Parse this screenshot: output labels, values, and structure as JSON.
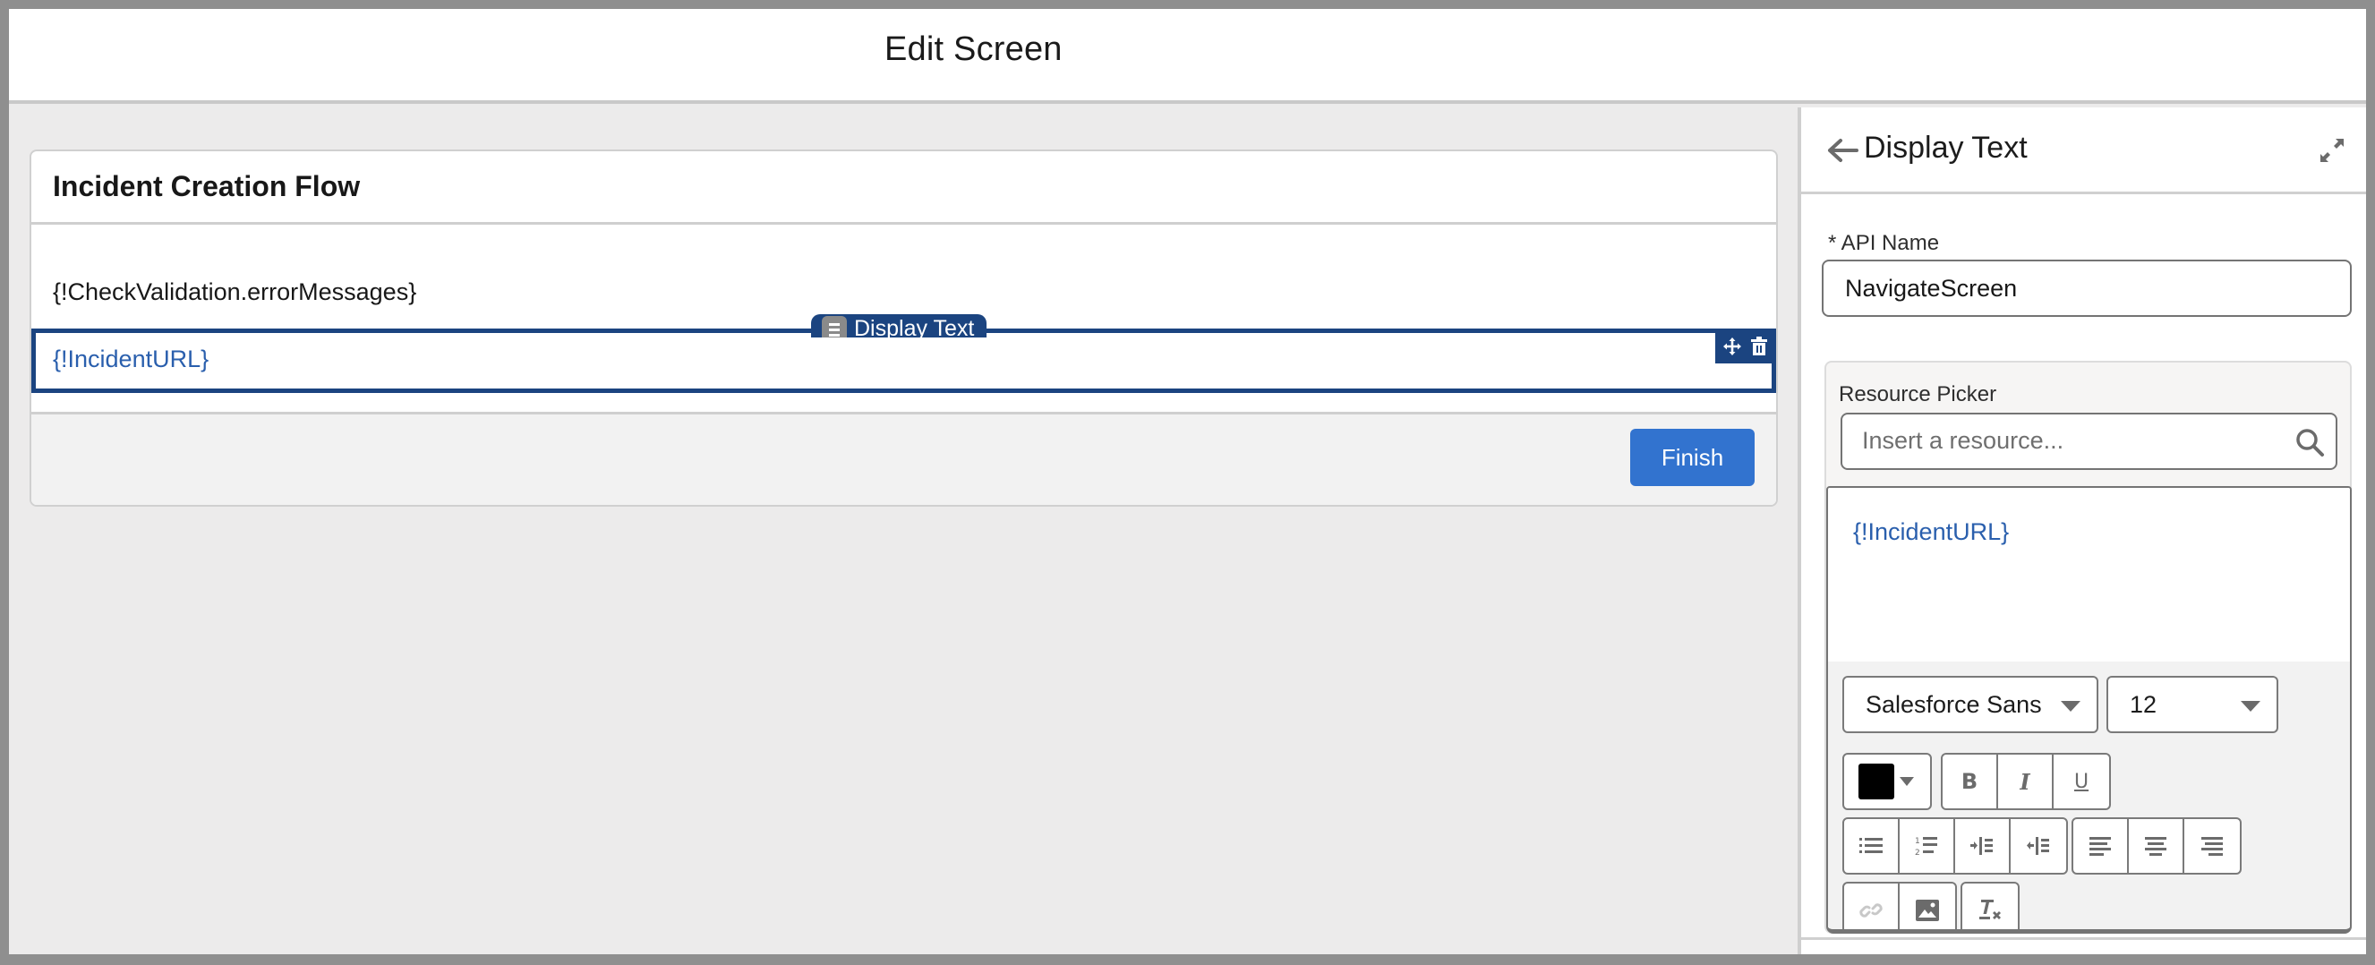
{
  "header": {
    "title": "Edit Screen"
  },
  "canvas": {
    "screen_title": "Incident Creation Flow",
    "components": [
      {
        "type": "display-text",
        "value": "{!CheckValidation.errorMessages}",
        "selected": false
      },
      {
        "type": "display-text",
        "value": "{!IncidentURL}",
        "selected": true
      }
    ],
    "selected_tag_label": "Display Text",
    "finish_label": "Finish"
  },
  "panel": {
    "title": "Display Text",
    "api_name_label": "* API Name",
    "api_name_value": "NavigateScreen",
    "resource_picker_label": "Resource Picker",
    "resource_picker_placeholder": "Insert a resource...",
    "editor_content": "{!IncidentURL}",
    "toolbar": {
      "font_family": "Salesforce Sans",
      "font_size": "12",
      "text_color": "#000000",
      "format_buttons": [
        "bold",
        "italic",
        "underline"
      ],
      "list_buttons": [
        "bulleted-list",
        "numbered-list",
        "indent",
        "outdent"
      ],
      "align_buttons": [
        "align-left",
        "align-center",
        "align-right"
      ],
      "insert_buttons": [
        "link",
        "image"
      ],
      "clear_format_button": "remove-formatting"
    }
  },
  "colors": {
    "selection_accent": "#1b4480",
    "link_text": "#2a5fad",
    "primary_button": "#3273cf"
  }
}
